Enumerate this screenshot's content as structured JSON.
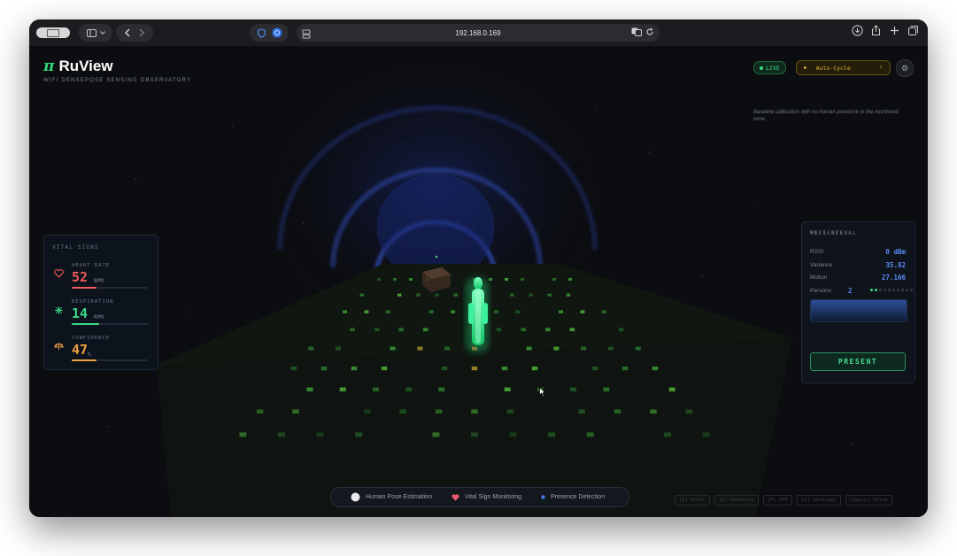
{
  "browser": {
    "url": "192.168.0.169",
    "icons": [
      "sidebar-icon",
      "chevron-down-icon",
      "back-icon",
      "forward-icon",
      "shield-icon",
      "extension-icon",
      "page-settings-icon",
      "translate-icon",
      "reload-icon",
      "download-icon",
      "share-icon",
      "new-tab-icon",
      "tabs-overview-icon"
    ]
  },
  "app": {
    "pi": "π",
    "title": "RuView",
    "subtitle": "WIFI DENSEPOSE SENSING OBSERVATORY",
    "live_label": "LIVE",
    "mode_label": "Auto-Cycle",
    "calibration_text": "Baseline calibration with no human presence in the monitored zone.",
    "accent_color": "#33d97a"
  },
  "vitals": {
    "title": "VITAL SIGNS",
    "items": [
      {
        "label": "HEART RATE",
        "value": "52",
        "unit": "BPM",
        "color": "#f05a5a",
        "icon": "heart-icon",
        "level": 0.32
      },
      {
        "label": "RESPIRATION",
        "value": "14",
        "unit": "RPM",
        "color": "#39d98a",
        "icon": "lungs-icon",
        "level": 0.36
      },
      {
        "label": "CONFIDENCE",
        "value": "47",
        "unit": "%",
        "color": "#f0a040",
        "icon": "scale-icon",
        "level": 0.33
      }
    ]
  },
  "wifi": {
    "title": "WIFI SIGNAL",
    "rssi_label": "RSSI",
    "rssi_value": "0 dBm",
    "variance_label": "Variance",
    "variance_value": "35.82",
    "motion_label": "Motion",
    "motion_value": "27.166",
    "persons_label": "Persons",
    "persons_value": "2",
    "persons_active": 2,
    "persons_total": 10,
    "presence_title": "PRESENCE",
    "presence_value": "PRESENT"
  },
  "features": [
    {
      "label": "Human Pose Estimation",
      "icon": "pose-dot-icon"
    },
    {
      "label": "Vital Sign Monitoring",
      "icon": "heart-icon"
    },
    {
      "label": "Presence Detection",
      "icon": "presence-dot-icon"
    }
  ],
  "shortcuts": [
    "[A] Orbit",
    "[D] Debounce",
    "[F] FPS",
    "[S] Settings",
    "[Space] Pulse"
  ]
}
